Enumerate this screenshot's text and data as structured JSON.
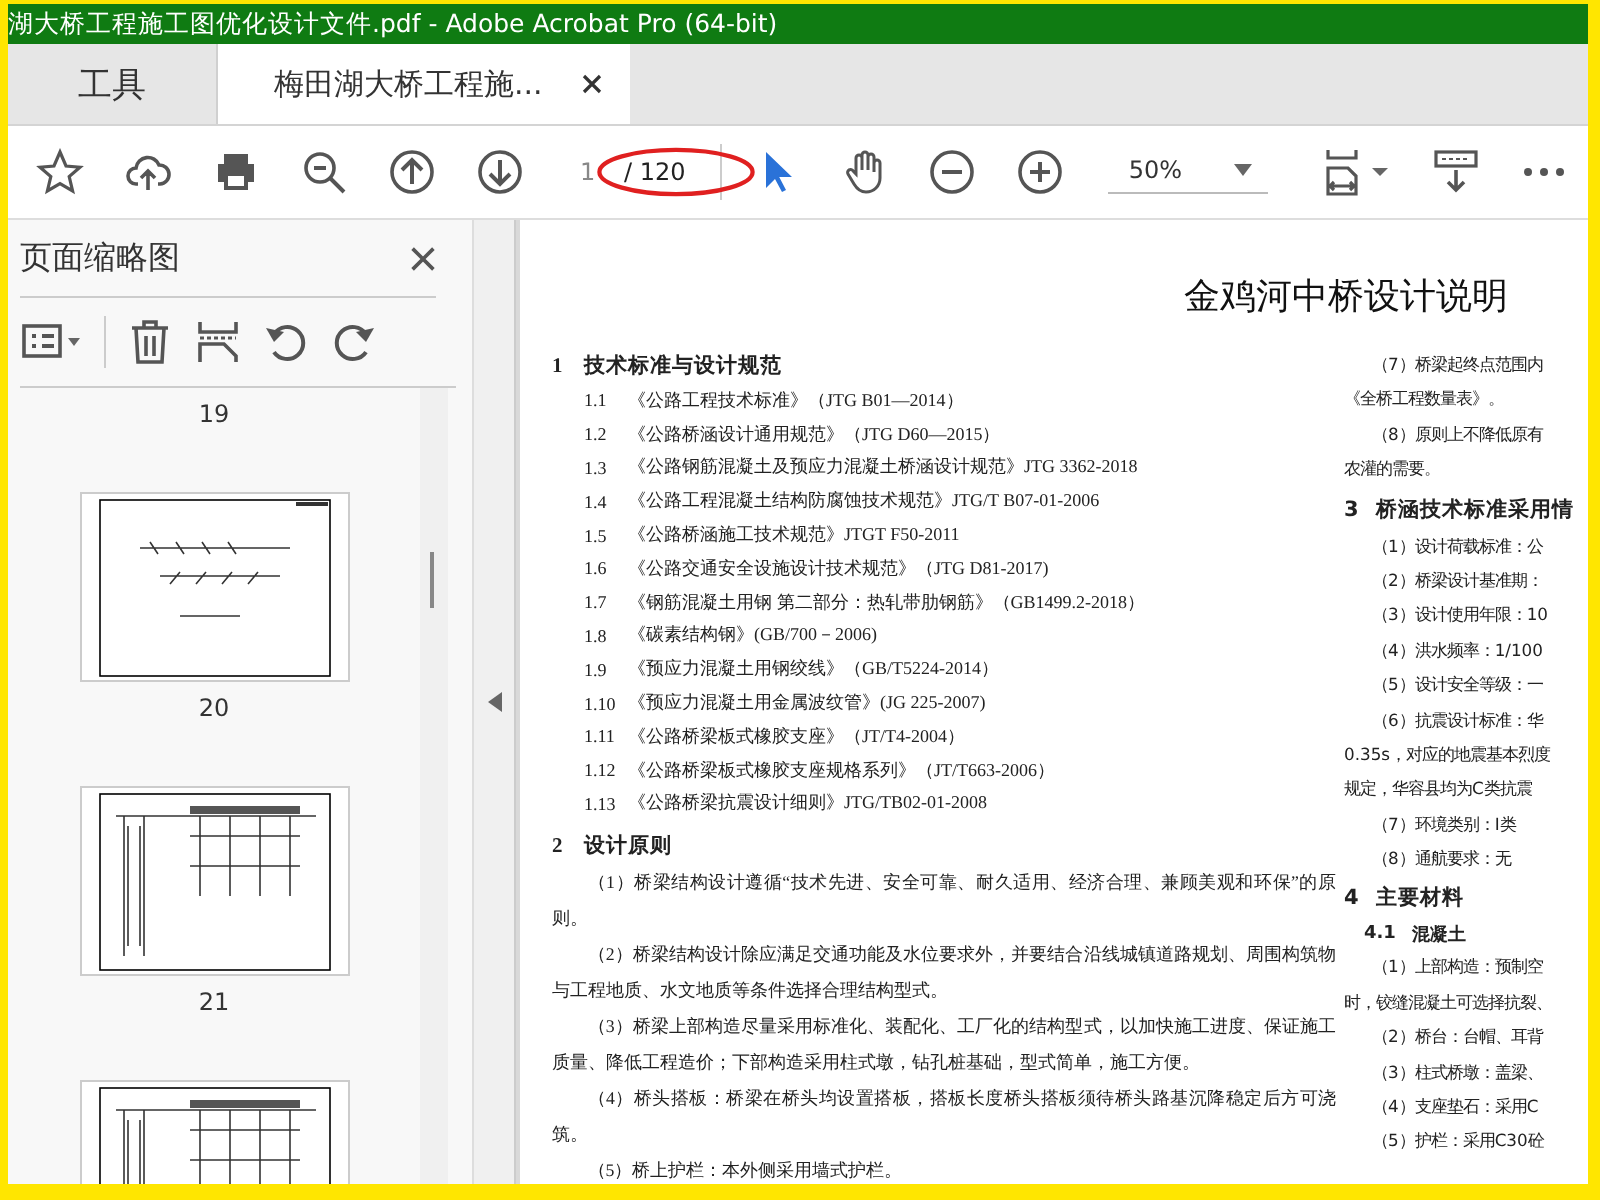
{
  "window": {
    "title": "湖大桥工程施工图优化设计文件.pdf - Adobe Acrobat Pro (64-bit)"
  },
  "tabs": [
    {
      "label": "工具",
      "selected": false,
      "closable": false
    },
    {
      "label": "梅田湖大桥工程施...",
      "selected": true,
      "closable": true
    }
  ],
  "toolbar": {
    "page_field": {
      "value": "1"
    },
    "page_total": "/ 120",
    "zoom": "50%"
  },
  "sidebar": {
    "title": "页面缩略图",
    "thumbnails": [
      {
        "kind": "none",
        "label": "19"
      },
      {
        "kind": "plan",
        "label": "20"
      },
      {
        "kind": "elevation",
        "label": "21"
      },
      {
        "kind": "elevation"
      }
    ]
  },
  "document": {
    "title": "金鸡河中桥设计说明",
    "left": [
      {
        "kind": "heading",
        "number": "1",
        "text": "技术标准与设计规范"
      },
      {
        "kind": "item",
        "number": "1.1",
        "text": "《公路工程技术标准》（JTG B01—2014）"
      },
      {
        "kind": "item",
        "number": "1.2",
        "text": "《公路桥涵设计通用规范》（JTG D60—2015）"
      },
      {
        "kind": "item",
        "number": "1.3",
        "text": "《公路钢筋混凝土及预应力混凝土桥涵设计规范》JTG 3362-2018"
      },
      {
        "kind": "item",
        "number": "1.4",
        "text": "《公路工程混凝土结构防腐蚀技术规范》JTG/T B07-01-2006"
      },
      {
        "kind": "item",
        "number": "1.5",
        "text": "《公路桥涵施工技术规范》JTGT F50-2011"
      },
      {
        "kind": "item",
        "number": "1.6",
        "text": "《公路交通安全设施设计技术规范》（JTG D81-2017)"
      },
      {
        "kind": "item",
        "number": "1.7",
        "text": "《钢筋混凝土用钢  第二部分：热轧带肋钢筋》（GB1499.2-2018）"
      },
      {
        "kind": "item",
        "number": "1.8",
        "text": "《碳素结构钢》(GB/700－2006)"
      },
      {
        "kind": "item",
        "number": "1.9",
        "text": "《预应力混凝土用钢绞线》（GB/T5224-2014）"
      },
      {
        "kind": "item",
        "number": "1.10",
        "text": "《预应力混凝土用金属波纹管》(JG 225-2007)"
      },
      {
        "kind": "item",
        "number": "1.11",
        "text": "《公路桥梁板式橡胶支座》（JT/T4-2004）"
      },
      {
        "kind": "item",
        "number": "1.12",
        "text": "《公路桥梁板式橡胶支座规格系列》（JT/T663-2006）"
      },
      {
        "kind": "item",
        "number": "1.13",
        "text": "《公路桥梁抗震设计细则》JTG/TB02-01-2008"
      },
      {
        "kind": "heading",
        "number": "2",
        "text": "设计原则"
      },
      {
        "kind": "para",
        "text": "（1）桥梁结构设计遵循“技术先进、安全可靠、耐久适用、经济合理、兼顾美观和环保”的原则。"
      },
      {
        "kind": "para",
        "text": "（2）桥梁结构设计除应满足交通功能及水位要求外，并要结合沿线城镇道路规划、周围构筑物与工程地质、水文地质等条件选择合理结构型式。"
      },
      {
        "kind": "para",
        "text": "（3）桥梁上部构造尽量采用标准化、装配化、工厂化的结构型式，以加快施工进度、保证施工质量、降低工程造价；下部构造采用柱式墩，钻孔桩基础，型式简单，施工方便。"
      },
      {
        "kind": "para",
        "text": "（4）桥头搭板：桥梁在桥头均设置搭板，搭板长度桥头搭板须待桥头路基沉降稳定后方可浇筑。"
      },
      {
        "kind": "para",
        "text": "（5）桥上护栏：本外侧采用墙式护栏。"
      }
    ],
    "right": [
      {
        "kind": "indent",
        "text": "（7）桥梁起终点范围内"
      },
      {
        "kind": "flush",
        "text": "《全桥工程数量表》。"
      },
      {
        "kind": "indent",
        "text": "（8）原则上不降低原有"
      },
      {
        "kind": "flush",
        "text": "农灌的需要。"
      },
      {
        "kind": "heading",
        "number": "3",
        "text": "桥涵技术标准采用情"
      },
      {
        "kind": "indent",
        "text": "（1）设计荷载标准：公"
      },
      {
        "kind": "indent",
        "text": "（2）桥梁设计基准期："
      },
      {
        "kind": "indent",
        "text": "（3）设计使用年限：10"
      },
      {
        "kind": "indent",
        "text": "（4）洪水频率：1/100"
      },
      {
        "kind": "indent",
        "text": "（5）设计安全等级：一"
      },
      {
        "kind": "indent",
        "text": "（6）抗震设计标准：华"
      },
      {
        "kind": "flush",
        "text": "0.35s，对应的地震基本烈度"
      },
      {
        "kind": "flush",
        "text": "规定，华容县均为C类抗震"
      },
      {
        "kind": "indent",
        "text": "（7）环境类别：Ⅰ类"
      },
      {
        "kind": "indent",
        "text": "（8）通航要求：无"
      },
      {
        "kind": "heading",
        "number": "4",
        "text": "主要材料"
      },
      {
        "kind": "subheading",
        "number": "4.1",
        "text": "混凝土"
      },
      {
        "kind": "indent",
        "text": "（1）上部构造：预制空"
      },
      {
        "kind": "flush",
        "text": "时，铰缝混凝土可选择抗裂、"
      },
      {
        "kind": "indent",
        "text": "（2）桥台：台帽、耳背"
      },
      {
        "kind": "indent",
        "text": "（3）柱式桥墩：盖梁、"
      },
      {
        "kind": "indent",
        "text": "（4）支座垫石：采用C"
      },
      {
        "kind": "indent",
        "text": "（5）护栏：采用C30砼"
      }
    ]
  }
}
